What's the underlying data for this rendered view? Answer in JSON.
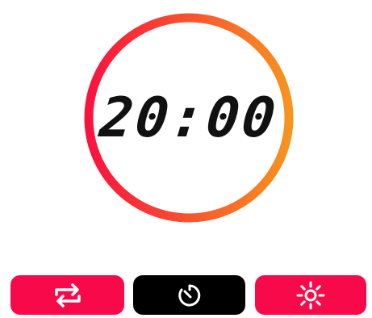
{
  "timer": {
    "display": "20:00",
    "ring_gradient": [
      "#f8133f",
      "#f7931f"
    ]
  },
  "controls": [
    {
      "name": "repeat",
      "icon": "repeat-icon",
      "color": "#f80a4a"
    },
    {
      "name": "timer",
      "icon": "timer-icon",
      "color": "#000000"
    },
    {
      "name": "brightness",
      "icon": "brightness-icon",
      "color": "#f80a4a"
    }
  ]
}
